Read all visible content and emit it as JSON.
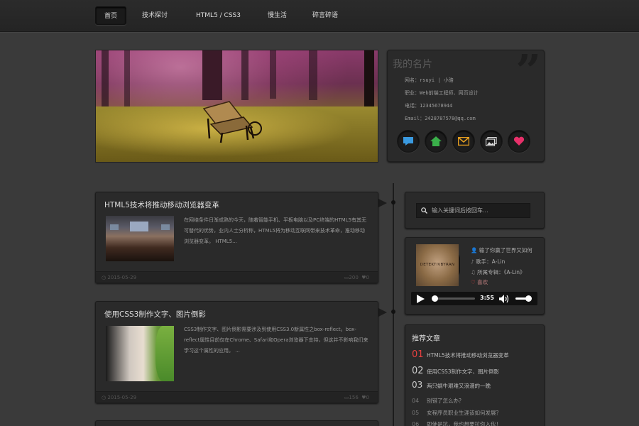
{
  "nav": {
    "items": [
      "首页",
      "技术探讨",
      "HTML5 / CSS3",
      "慢生活",
      "碎言碎语"
    ],
    "active": 0
  },
  "card": {
    "title": "我的名片",
    "name": "网名：rsuyi | 小骆",
    "job": "职业：Web前端工程师、网页设计",
    "phone": "电话：12345678944",
    "email": "Email：2428787578@qq.com",
    "icons": [
      "chat-bubble-icon",
      "home-icon",
      "mail-icon",
      "gallery-icon",
      "heart-icon"
    ]
  },
  "posts": [
    {
      "title": "HTML5技术将推动移动浏览器变革",
      "text": "在网络条件日渐成熟的今天，随着智能手机、平板电脑以及PC终端的HTML5有其无可替代的优势，业内人士分析称，HTML5将为移动互联网带来技术革命，推动移动浏览器变革。 HTML5...",
      "date": "2015-05-29",
      "views": "200",
      "likes": "0"
    },
    {
      "title": "使用CSS3制作文字、图片倒影",
      "text": "CSS3制作文字、图片倒影需要涉及到使用CSS3.0新属性之box-reflect。box-reflect属性目前仅在Chrome、Safari和Opera浏览器下支持，但这并不影响我们来学习这个属性的应用。 ...",
      "date": "2015-05-29",
      "views": "156",
      "likes": "0"
    }
  ],
  "search": {
    "placeholder": "输入关键词后按回车..."
  },
  "music": {
    "album_text": "DETEKTIVBYRAN",
    "song": "输了你赢了世界又如何",
    "singer": "歌手：A-Lin",
    "album": "所属专辑：《A-Lin》",
    "like": "喜欢",
    "time": "3:55",
    "progress": 0.05,
    "volume": 0.8
  },
  "recommend": {
    "title": "推荐文章",
    "items": [
      {
        "num": "01",
        "text": "HTML5技术将推动移动浏览器变革"
      },
      {
        "num": "02",
        "text": "使用CSS3制作文字、图片倒影"
      },
      {
        "num": "03",
        "text": "两只蜗牛艰难又浪漫的一晚"
      },
      {
        "num": "04",
        "text": "别错了怎么办？"
      },
      {
        "num": "05",
        "text": "女程序员职业生涯该如何发展？"
      },
      {
        "num": "06",
        "text": "即使是坑，我也想要拉你入伙！"
      }
    ]
  },
  "colors": {
    "accent_red": "#e84040",
    "bg": "#3a3a3a",
    "panel": "#2a2a2a"
  }
}
